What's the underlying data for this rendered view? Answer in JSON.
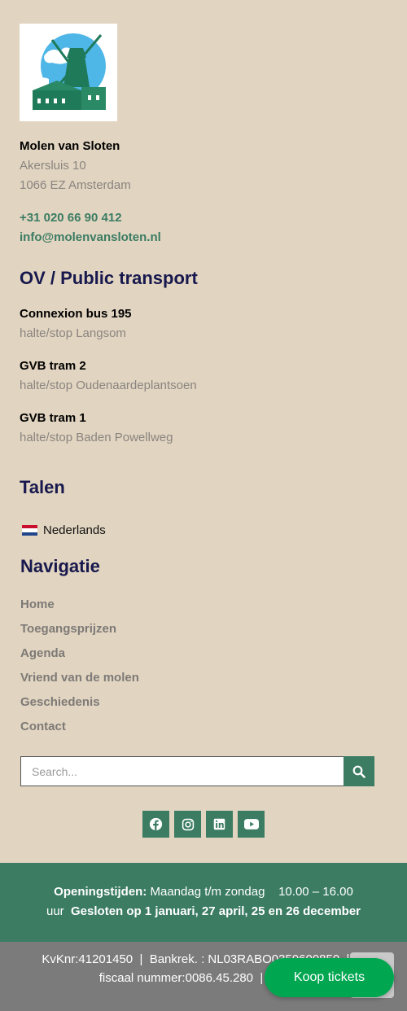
{
  "org": {
    "name": "Molen van Sloten",
    "address_line1": "Akersluis 10",
    "address_line2": "1066 EZ  Amsterdam",
    "phone": "+31 020 66 90 412",
    "email": "info@molenvansloten.nl"
  },
  "transport": {
    "heading": "OV / Public transport",
    "stops": [
      {
        "title": "Connexion bus 195",
        "sub": "halte/stop Langsom"
      },
      {
        "title": "GVB tram 2",
        "sub": "halte/stop Oudenaardeplantsoen"
      },
      {
        "title": "GVB tram 1",
        "sub": "halte/stop Baden Powellweg"
      }
    ]
  },
  "languages": {
    "heading": "Talen",
    "current": "Nederlands"
  },
  "navigation": {
    "heading": "Navigatie",
    "items": [
      "Home",
      "Toegangsprijzen",
      "Agenda",
      "Vriend van de molen",
      "Geschiedenis",
      "Contact"
    ]
  },
  "search": {
    "placeholder": "Search...",
    "value": ""
  },
  "social": [
    "facebook-icon",
    "instagram-icon",
    "linkedin-icon",
    "youtube-icon"
  ],
  "hours": {
    "label": "Openingstijden:",
    "line1_text": " Maandag t/m zondag    10.00 – 16.00",
    "line2_prefix": "uur  ",
    "closed": "Gesloten op 1 januari, 27 april, 25 en 26 december"
  },
  "legal": {
    "line1": "KvKnr:41201450  |  Bankrek. : NL03RABO0350600850  |  R",
    "line2": "fiscaal nummer:0086.45.280  |  BTWnr"
  },
  "cta": {
    "label": "Koop tickets"
  },
  "colors": {
    "background": "#e1d4c0",
    "accent_green": "#3b7c63",
    "heading_navy": "#17184d",
    "cta_green": "#00a650"
  }
}
